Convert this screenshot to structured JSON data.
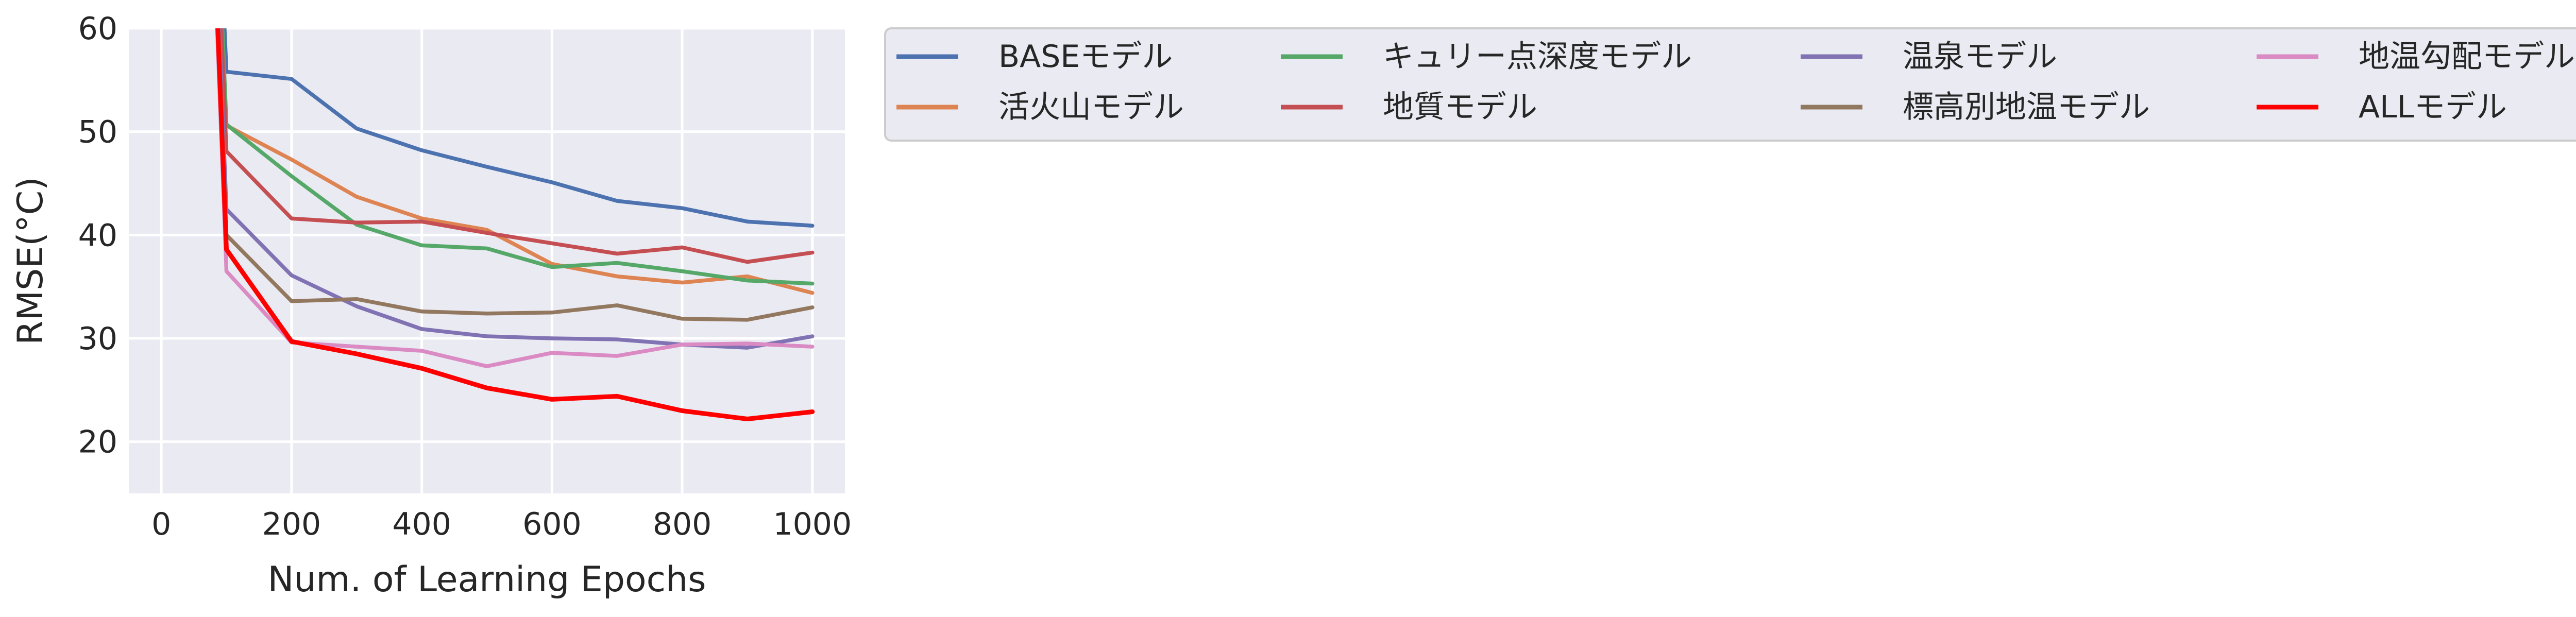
{
  "chart_data": {
    "type": "line",
    "title": "",
    "xlabel": "Num. of Learning Epochs",
    "ylabel": "RMSE(°C)",
    "xlim": [
      -50,
      1050
    ],
    "ylim": [
      15,
      60
    ],
    "xticks": [
      0,
      200,
      400,
      600,
      800,
      1000
    ],
    "yticks": [
      20,
      30,
      40,
      50,
      60
    ],
    "grid": true,
    "legend_position": "outside-right, 4 columns",
    "x": [
      0,
      100,
      200,
      300,
      400,
      500,
      600,
      700,
      800,
      900,
      1000
    ],
    "series": [
      {
        "name": "BASEモデル",
        "color": "#4c72b0",
        "values": [
          200,
          55.8,
          55.1,
          50.3,
          48.2,
          46.6,
          45.1,
          43.3,
          42.6,
          41.3,
          40.9
        ]
      },
      {
        "name": "活火山モデル",
        "color": "#dd8452",
        "values": [
          200,
          50.6,
          47.3,
          43.7,
          41.6,
          40.5,
          37.2,
          36.0,
          35.4,
          36.0,
          34.4
        ]
      },
      {
        "name": "キュリー点深度モデル",
        "color": "#55a868",
        "values": [
          200,
          50.7,
          45.7,
          41.0,
          39.0,
          38.7,
          36.9,
          37.3,
          36.5,
          35.6,
          35.3
        ]
      },
      {
        "name": "地質モデル",
        "color": "#c44e52",
        "values": [
          200,
          48.1,
          41.6,
          41.2,
          41.3,
          40.2,
          39.2,
          38.2,
          38.8,
          37.4,
          38.3
        ]
      },
      {
        "name": "温泉モデル",
        "color": "#8172b3",
        "values": [
          200,
          42.5,
          36.1,
          33.1,
          30.9,
          30.2,
          30.0,
          29.9,
          29.4,
          29.1,
          30.2
        ]
      },
      {
        "name": "標高別地温モデル",
        "color": "#937860",
        "values": [
          200,
          40.0,
          33.6,
          33.8,
          32.6,
          32.4,
          32.5,
          33.2,
          31.9,
          31.8,
          33.0
        ]
      },
      {
        "name": "地温勾配モデル",
        "color": "#da8bc3",
        "values": [
          200,
          36.5,
          29.6,
          29.2,
          28.8,
          27.3,
          28.6,
          28.3,
          29.4,
          29.5,
          29.2
        ]
      },
      {
        "name": "ALLモデル",
        "color": "#ff0000",
        "values": [
          200,
          38.6,
          29.7,
          28.5,
          27.1,
          25.2,
          24.1,
          24.4,
          23.0,
          22.2,
          22.9
        ]
      }
    ]
  }
}
